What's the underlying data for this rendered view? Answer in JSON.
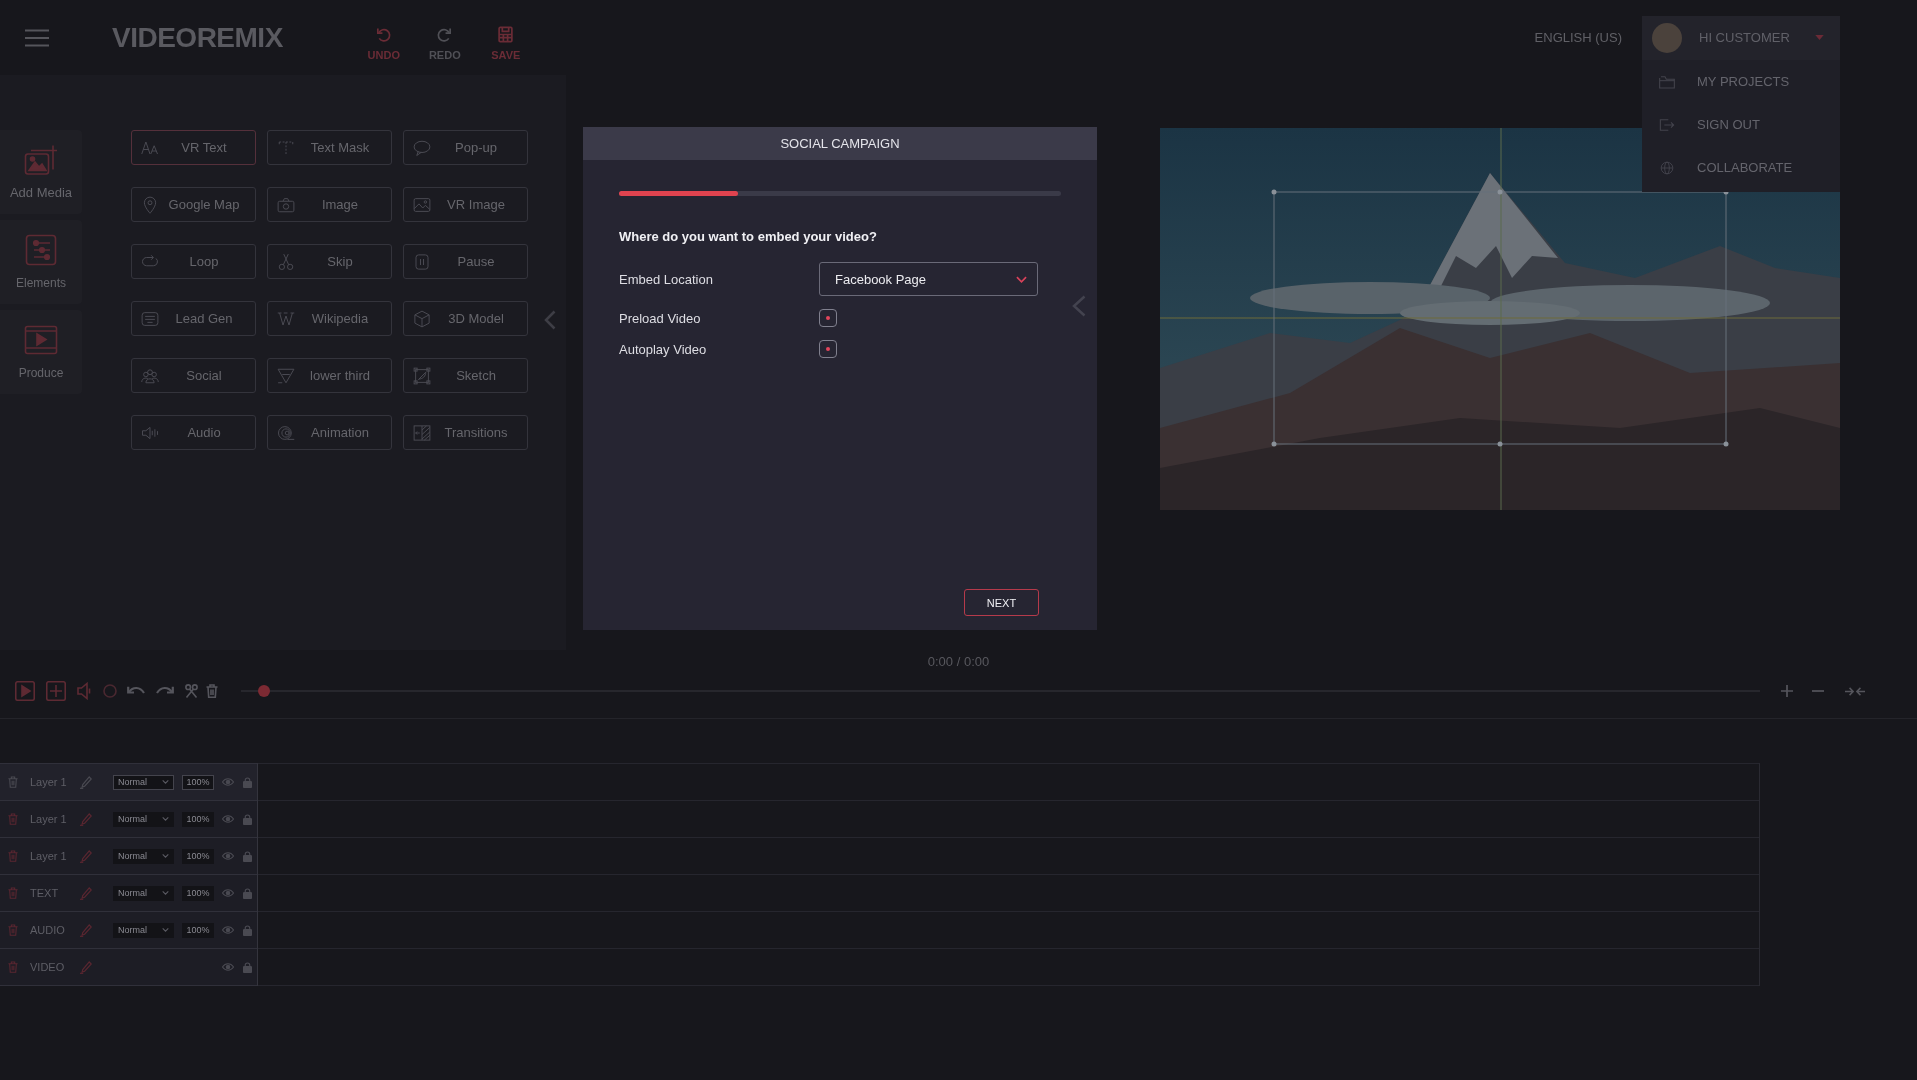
{
  "top_bar": {
    "logo": "VIDEOREMIX",
    "actions": [
      {
        "kind": "undo",
        "label": "UNDO",
        "disabled": false
      },
      {
        "kind": "redo",
        "label": "REDO",
        "disabled": true
      },
      {
        "kind": "save",
        "label": "SAVE",
        "disabled": false
      }
    ],
    "language": "ENGLISH (US)",
    "user": {
      "greeting": "HI CUSTOMER",
      "expanded": true,
      "menu": [
        {
          "kind": "projects",
          "label": "MY PROJECTS"
        },
        {
          "kind": "signout",
          "label": "SIGN OUT"
        },
        {
          "kind": "collaborate",
          "label": "COLLABORATE"
        }
      ]
    }
  },
  "sidebar": {
    "items": [
      {
        "kind": "media",
        "label": "Add Media"
      },
      {
        "kind": "elements",
        "label": "Elements"
      },
      {
        "kind": "produce",
        "label": "Produce"
      }
    ]
  },
  "elements": [
    {
      "kind": "text",
      "label": "VR Text",
      "selected": true
    },
    {
      "kind": "mask",
      "label": "Text Mask",
      "selected": false
    },
    {
      "kind": "popup",
      "label": "Pop-up",
      "selected": false
    },
    {
      "kind": "map",
      "label": "Google Map",
      "selected": false
    },
    {
      "kind": "image",
      "label": "Image",
      "selected": false
    },
    {
      "kind": "vrimage",
      "label": "VR Image",
      "selected": false
    },
    {
      "kind": "loop",
      "label": "Loop",
      "selected": false
    },
    {
      "kind": "skip",
      "label": "Skip",
      "selected": false
    },
    {
      "kind": "pause",
      "label": "Pause",
      "selected": false
    },
    {
      "kind": "form",
      "label": "Lead Gen",
      "selected": false
    },
    {
      "kind": "wiki",
      "label": "Wikipedia",
      "selected": false
    },
    {
      "kind": "cube",
      "label": "3D Model",
      "selected": false
    },
    {
      "kind": "social",
      "label": "Social",
      "selected": false
    },
    {
      "kind": "lower",
      "label": "lower third",
      "selected": false
    },
    {
      "kind": "sketch",
      "label": "Sketch",
      "selected": false
    },
    {
      "kind": "audio",
      "label": "Audio",
      "selected": false
    },
    {
      "kind": "animation",
      "label": "Animation",
      "selected": false
    },
    {
      "kind": "transitions",
      "label": "Transitions",
      "selected": false
    }
  ],
  "modal": {
    "title": "SOCIAL CAMPAIGN",
    "progress": {
      "level": 0.27
    },
    "question": "Where do you want to embed your video?",
    "fields": [
      {
        "kind": "select",
        "label": "Embed Location",
        "value": "Facebook Page"
      },
      {
        "kind": "checkbox",
        "label": "Preload Video",
        "checked": true
      },
      {
        "kind": "checkbox",
        "label": "Autoplay Video",
        "checked": true
      }
    ],
    "next_button": "NEXT"
  },
  "timeline": {
    "time": "0:00 / 0:00",
    "scrubber": {
      "level": 0.015
    },
    "layers": [
      {
        "name": "Layer 1",
        "blend": "Normal",
        "opacity": "100%",
        "selected": true
      },
      {
        "name": "Layer 1",
        "blend": "Normal",
        "opacity": "100%",
        "selected": false
      },
      {
        "name": "Layer 1",
        "blend": "Normal",
        "opacity": "100%",
        "selected": false
      },
      {
        "name": "TEXT",
        "blend": "Normal",
        "opacity": "100%",
        "selected": false
      },
      {
        "name": "AUDIO",
        "blend": "Normal",
        "opacity": "100%",
        "selected": false
      },
      {
        "name": "VIDEO",
        "selected": false
      }
    ]
  }
}
